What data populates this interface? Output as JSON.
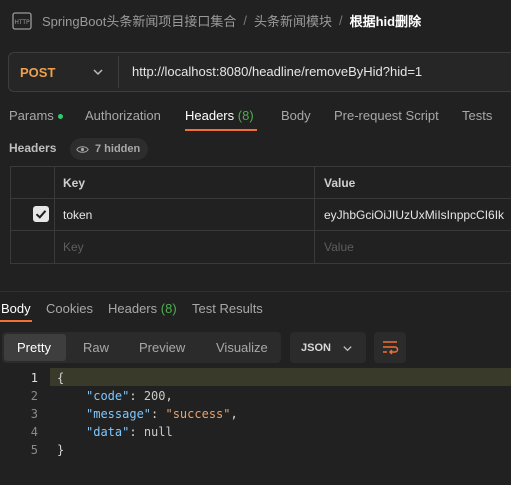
{
  "breadcrumb": {
    "icon": "http-icon",
    "segments": [
      "SpringBoot头条新闻项目接口集合",
      "头条新闻模块"
    ],
    "separator": "/",
    "current": "根据hid删除"
  },
  "request": {
    "method": "POST",
    "url": "http://localhost:8080/headline/removeByHid?hid=1"
  },
  "tabs": {
    "params": "Params",
    "authorization": "Authorization",
    "headers": "Headers",
    "headers_count": "(8)",
    "body": "Body",
    "prerequest": "Pre-request Script",
    "tests": "Tests"
  },
  "headers_section": {
    "title": "Headers",
    "hidden_label": "7 hidden",
    "columns": [
      "Key",
      "Value"
    ],
    "rows": [
      {
        "key": "token",
        "value": "eyJhbGciOiJIUzUxMiIsInppcCI6Ik",
        "checked": true
      }
    ],
    "placeholder": {
      "key": "Key",
      "value": "Value"
    }
  },
  "response": {
    "tabs": {
      "body": "Body",
      "cookies": "Cookies",
      "headers": "Headers",
      "headers_count": "(8)",
      "test_results": "Test Results"
    },
    "views": [
      "Pretty",
      "Raw",
      "Preview",
      "Visualize"
    ],
    "active_view": "Pretty",
    "format": "JSON",
    "code": {
      "line_numbers": [
        "1",
        "2",
        "3",
        "4",
        "5"
      ],
      "open": "{",
      "close": "}",
      "code_key": "\"code\"",
      "code_value": "200",
      "message_key": "\"message\"",
      "message_value": "\"success\"",
      "data_key": "\"data\"",
      "data_value": "null"
    }
  },
  "colors": {
    "accent": "#f36f35",
    "method": "#f0a04b",
    "count": "#4caf50",
    "json_key": "#7fc8ff",
    "json_string": "#e8a26e"
  }
}
